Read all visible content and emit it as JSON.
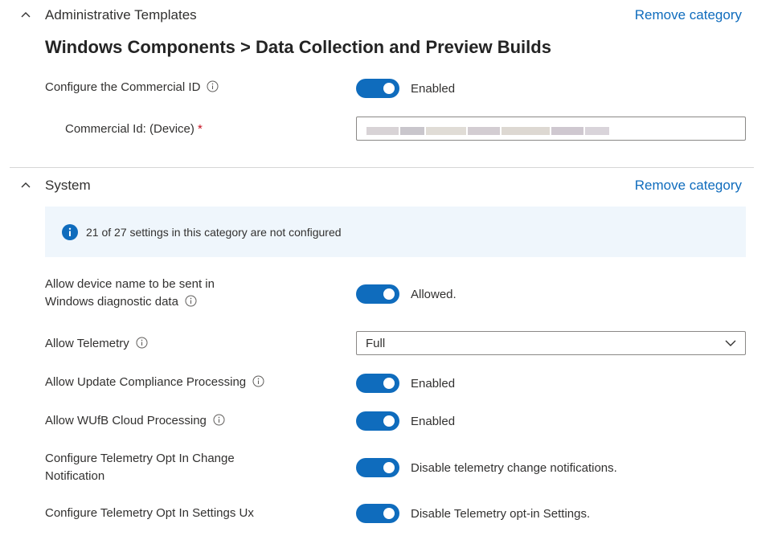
{
  "admin_templates": {
    "title": "Administrative Templates",
    "remove_label": "Remove category",
    "section_title": "Windows Components > Data Collection and Preview Builds",
    "commercial_id_setting": {
      "label": "Configure the Commercial ID",
      "state": "Enabled"
    },
    "commercial_id_field": {
      "label": "Commercial Id: (Device)",
      "required_mark": "*"
    }
  },
  "system": {
    "title": "System",
    "remove_label": "Remove category",
    "banner_text": "21 of 27 settings in this category are not configured",
    "settings": [
      {
        "label_line1": "Allow device name to be sent in",
        "label_line2": "Windows diagnostic data",
        "state": "Allowed."
      },
      {
        "label": "Allow Telemetry",
        "value": "Full"
      },
      {
        "label": "Allow Update Compliance Processing",
        "state": "Enabled"
      },
      {
        "label": "Allow WUfB Cloud Processing",
        "state": "Enabled"
      },
      {
        "label_line1": "Configure Telemetry Opt In Change",
        "label_line2": "Notification",
        "state": "Disable telemetry change notifications."
      },
      {
        "label": "Configure Telemetry Opt In Settings Ux",
        "state": "Disable Telemetry opt-in Settings."
      }
    ]
  },
  "colors": {
    "accent": "#0f6cbd",
    "banner_bg": "#eff6fc",
    "required": "#c50f1f"
  },
  "icons": {
    "collapse": "chevron-up-icon",
    "info": "info-icon",
    "banner_info": "info-circle-filled-icon",
    "dropdown": "chevron-down-icon"
  }
}
